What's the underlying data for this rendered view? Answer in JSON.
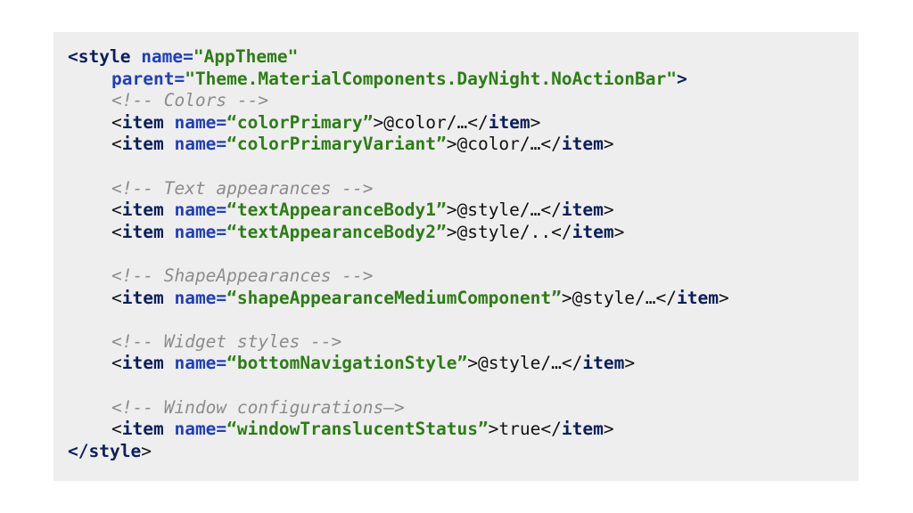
{
  "colors": {
    "panel_bg": "#eeeeee",
    "tag": "#0b1f5c",
    "attribute": "#1f3fbf",
    "value": "#2d7d16",
    "comment": "#8c8c8c",
    "text": "#111111"
  },
  "code": {
    "style_open": "<style",
    "style_name_attr": " name=",
    "style_name_value": "\"AppTheme\"",
    "style_parent_attr": "parent=",
    "style_parent_value": "\"Theme.MaterialComponents.DayNight.NoActionBar\"",
    "style_parent_close": ">",
    "comment_colors": "<!-- Colors -->",
    "comment_text": "<!-- Text appearances -->",
    "comment_shape": "<!-- ShapeAppearances -->",
    "comment_widget": "<!-- Widget styles -->",
    "comment_window": "<!-- Window configurations—>",
    "style_close_tag": "</style",
    "style_close_bracket": ">",
    "items": [
      {
        "name": "“colorPrimary”",
        "value": "@color/…"
      },
      {
        "name": "“colorPrimaryVariant”",
        "value": "@color/…"
      },
      {
        "name": "“textAppearanceBody1”",
        "value": "@style/…"
      },
      {
        "name": "“textAppearanceBody2”",
        "value": "@style/.."
      },
      {
        "name": "“shapeAppearanceMediumComponent”",
        "value": "@style/…"
      },
      {
        "name": "“bottomNavigationStyle”",
        "value": "@style/…"
      },
      {
        "name": "“windowTranslucentStatus”",
        "value": "true"
      }
    ],
    "item_open_lt": "<",
    "item_tag": "item",
    "item_name_attr": " name=",
    "item_gt": ">",
    "item_close_lt": "</",
    "item_close_gt": ">"
  }
}
